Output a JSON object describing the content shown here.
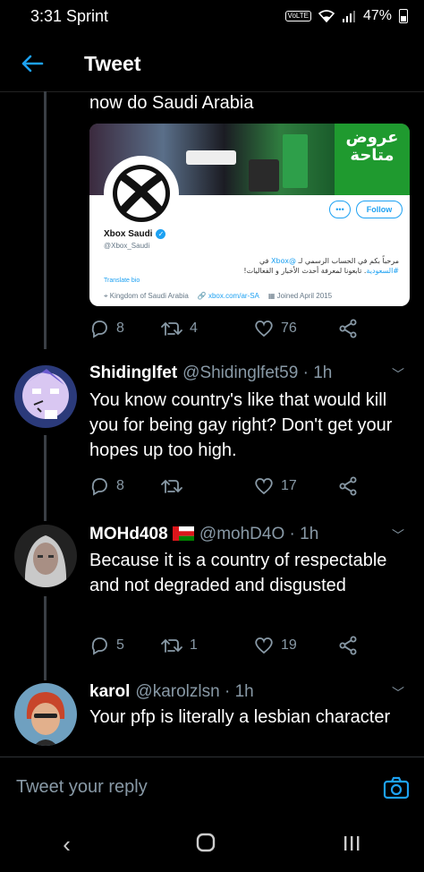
{
  "status_bar": {
    "time": "3:31 Sprint",
    "volte": "VoLTE",
    "battery": "47%"
  },
  "header": {
    "title": "Tweet"
  },
  "quoted": {
    "text": "now do Saudi Arabia",
    "card": {
      "banner_text": "عروض متاحة",
      "name": "Xbox Saudi",
      "handle": "@Xbox_Saudi",
      "bio_pre": "مرحباً بكم في الحساب الرسمي لـ ",
      "bio_link1": "@Xbox",
      "bio_mid": " في ",
      "bio_link2": "#السعودية",
      "bio_post": ". تابعونا لمعرفة أحدث الأخبار و الفعاليات!",
      "translate": "Translate bio",
      "location": "Kingdom of Saudi Arabia",
      "website": "xbox.com/ar-SA",
      "joined": "Joined April 2015",
      "follow": "Follow",
      "more": "•••"
    },
    "stats": {
      "replies": "8",
      "retweets": "4",
      "likes": "76"
    }
  },
  "replies": [
    {
      "name": "Shidinglfet",
      "handle": "@Shidinglfet59",
      "time": "· 1h",
      "text": "You know country's like that would kill you for being gay right? Don't get your hopes up too high.",
      "stats": {
        "replies": "8",
        "retweets": "",
        "likes": "17"
      }
    },
    {
      "name": "MOHd408",
      "handle": "@mohD4O",
      "time": "· 1h",
      "text": "Because it is a country of respectable and not degraded and disgusted",
      "stats": {
        "replies": "5",
        "retweets": "1",
        "likes": "19"
      }
    },
    {
      "name": "karol",
      "handle": "@karolzlsn",
      "time": "· 1h",
      "text": "Your pfp is literally a lesbian character"
    }
  ],
  "compose": {
    "placeholder": "Tweet your reply"
  },
  "colors": {
    "accent": "#1da1f2",
    "muted": "#8899a6",
    "xbox_green": "#107c10"
  }
}
